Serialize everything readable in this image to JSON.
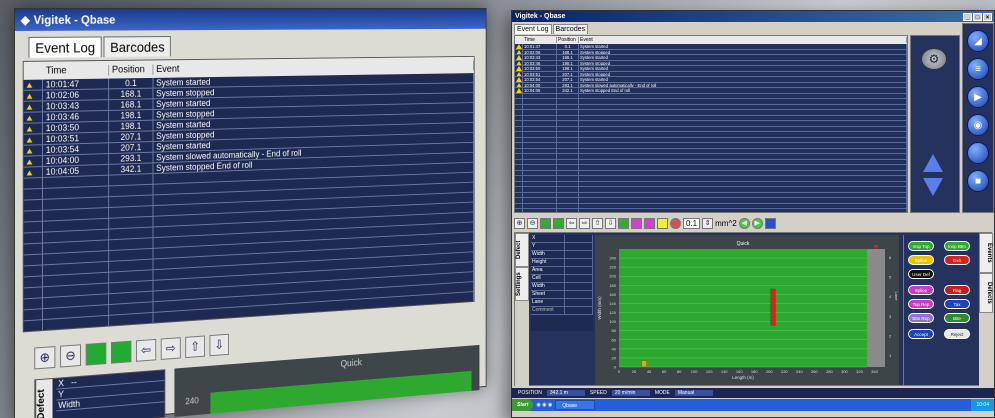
{
  "app": {
    "title": "Vigitek - Qbase"
  },
  "tabs": [
    {
      "label": "Event Log"
    },
    {
      "label": "Barcodes"
    }
  ],
  "event_log": {
    "columns": {
      "time": "Time",
      "position": "Position",
      "event": "Event"
    },
    "rows": [
      {
        "time": "10:01:47",
        "position": "0.1",
        "event": "System started"
      },
      {
        "time": "10:02:06",
        "position": "168.1",
        "event": "System stopped"
      },
      {
        "time": "10:03:43",
        "position": "168.1",
        "event": "System started"
      },
      {
        "time": "10:03:46",
        "position": "198.1",
        "event": "System stopped"
      },
      {
        "time": "10:03:50",
        "position": "198.1",
        "event": "System started"
      },
      {
        "time": "10:03:51",
        "position": "207.1",
        "event": "System stopped"
      },
      {
        "time": "10:03:54",
        "position": "207.1",
        "event": "System started"
      },
      {
        "time": "10:04:00",
        "position": "293.1",
        "event": "System slowed automatically - End of roll"
      },
      {
        "time": "10:04:05",
        "position": "342.1",
        "event": "System stopped End of roll"
      }
    ]
  },
  "toolbar": {
    "threshold_value": "0.1",
    "threshold_unit": "mm^2"
  },
  "defect_panel": {
    "tabs": [
      {
        "label": "Defect"
      },
      {
        "label": "Settings"
      }
    ],
    "fields": [
      "X",
      "Y",
      "Width",
      "Height",
      "Area",
      "Cell",
      "Width",
      "Sheet",
      "Lane"
    ],
    "comment_label": "Comment",
    "left_fields": [
      "X",
      "Y",
      "Width"
    ],
    "left_value": "--"
  },
  "events_panel": {
    "tabs": [
      {
        "label": "Events"
      },
      {
        "label": "Defects"
      }
    ],
    "buttons": [
      {
        "label": "Insp Top",
        "color": "#2ea82e"
      },
      {
        "label": "Insp Btm",
        "color": "#2ea82e"
      },
      {
        "label": "Splice",
        "color": "#e8c400"
      },
      {
        "label": "Exit",
        "color": "#d82020"
      },
      {
        "label": "User Def",
        "color": "#111111"
      },
      {
        "label": "Splice",
        "color": "#c040c0"
      },
      {
        "label": "Flag",
        "color": "#c02020"
      },
      {
        "label": "Top Rep",
        "color": "#c040c0"
      },
      {
        "label": "Tax",
        "color": "#2040c0"
      },
      {
        "label": "Bite Rep",
        "color": "#9070d0"
      },
      {
        "label": "Bite",
        "color": "#2e8a2e"
      },
      {
        "label": "Accept",
        "color": "#2040c0"
      },
      {
        "label": "Reject",
        "color": "#e8e8e8"
      }
    ]
  },
  "status_bar": {
    "position_label": "POSITION",
    "position_value": "342.1 m",
    "speed_label": "SPEED",
    "speed_value": "20 m/min",
    "mode_label": "MODE",
    "mode_value": "Manual"
  },
  "taskbar": {
    "start_label": "Start",
    "task_label": "Qbase",
    "clock": "10:04"
  },
  "colors": {
    "grid_green": "#2fa82f",
    "marker_red": "#e81c1c",
    "marker_yellow": "#d8b000",
    "panel_navy": "#25325e"
  },
  "chart_data": {
    "type": "scatter",
    "title": "Quick",
    "xlabel": "Length (m)",
    "ylabel": "Width (mm)",
    "xlim": [
      0,
      330
    ],
    "ylim": [
      0,
      260
    ],
    "x_ticks": [
      0,
      20,
      40,
      60,
      80,
      100,
      120,
      140,
      160,
      180,
      200,
      220,
      240,
      260,
      280,
      300,
      320,
      340
    ],
    "y_ticks": [
      0,
      20,
      40,
      60,
      80,
      100,
      120,
      140,
      160,
      180,
      200,
      220,
      240
    ],
    "lanes_label": "Lane",
    "lane_ticks": [
      1,
      2,
      3,
      4,
      5,
      6
    ],
    "defects": [
      {
        "x_start": 202,
        "x_end": 208,
        "y_start": 92,
        "y_end": 172,
        "color": "#e81c1c"
      },
      {
        "x_start": 30,
        "x_end": 37,
        "y_start": 0,
        "y_end": 14,
        "color": "#d8b000"
      }
    ],
    "grid": true
  }
}
